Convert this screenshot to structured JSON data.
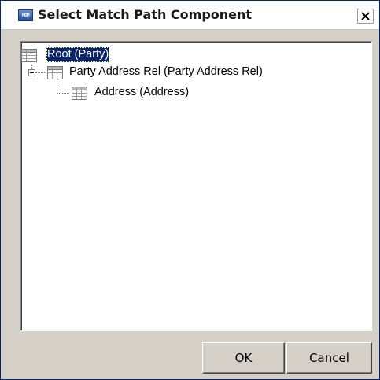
{
  "dialog": {
    "title": "Select Match Path Component",
    "title_icon_text": "MDM",
    "close_label": "Close"
  },
  "tree": {
    "nodes": [
      {
        "label": "Root (Party)",
        "selected": true,
        "expanded": true
      },
      {
        "label": "Party Address Rel (Party Address Rel)",
        "selected": false,
        "expanded": true
      },
      {
        "label": "Address (Address)",
        "selected": false,
        "expanded": false
      }
    ]
  },
  "buttons": {
    "ok_label": "OK",
    "cancel_label": "Cancel"
  },
  "colors": {
    "selection_bg": "#0a246a",
    "dialog_bg": "#d4d0c8"
  },
  "icons": {
    "title": "mdm-app-icon",
    "close": "close-icon",
    "node": "table-icon",
    "expander": "collapse-minus-icon"
  }
}
